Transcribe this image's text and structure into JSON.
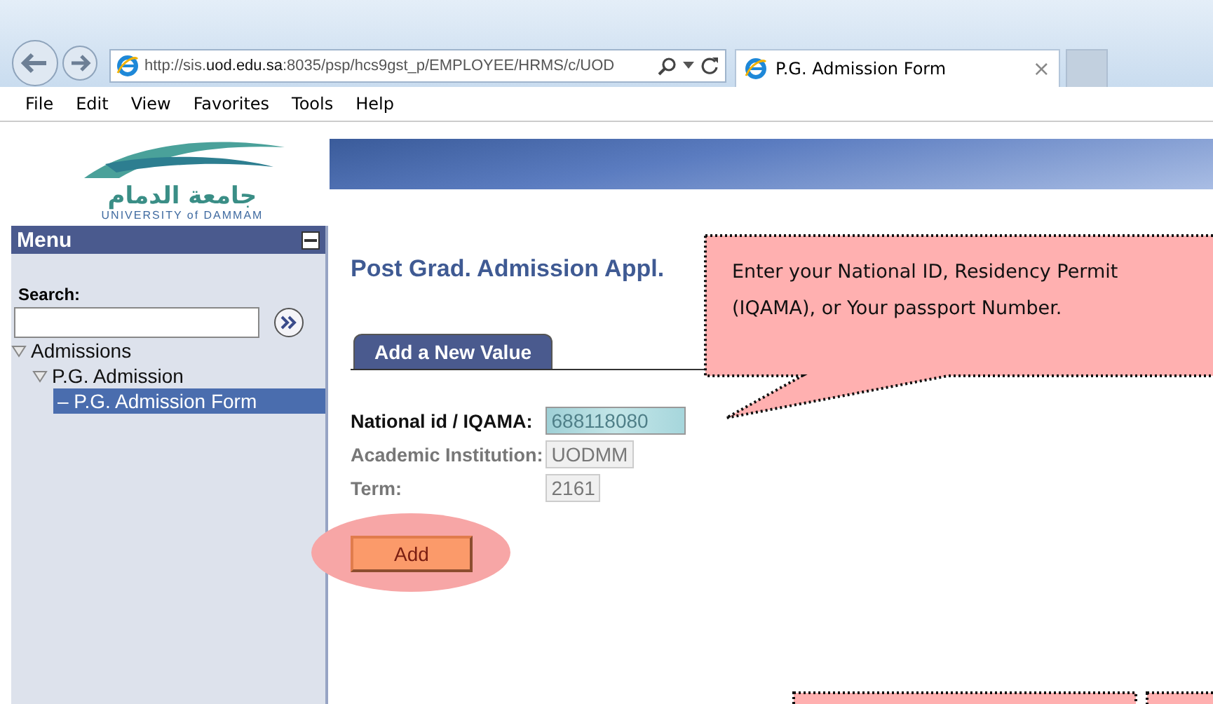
{
  "browser": {
    "address": "http://sis.**uod.edu.sa**:8035/psp/hcs9gst_p/EMPLOYEE/HRMS/c/UOD",
    "tab_title": "P.G. Admission Form",
    "tab_close": "×",
    "menu": [
      "File",
      "Edit",
      "View",
      "Favorites",
      "Tools",
      "Help"
    ]
  },
  "logo": {
    "arabic": "جامعة الدمام",
    "english": "UNIVERSITY of DAMMAM"
  },
  "sidebar": {
    "title": "Menu",
    "search_label": "Search:",
    "tree": [
      {
        "label": "Admissions",
        "expanded": true,
        "selected": false,
        "children": [
          {
            "label": "P.G. Admission",
            "expanded": true,
            "selected": false,
            "children": [
              {
                "label": "– P.G. Admission Form",
                "selected": true
              }
            ]
          }
        ]
      }
    ]
  },
  "page_title": "Post Grad. Admission Appl.",
  "tabs": [
    {
      "label": "Add a New Value",
      "selected": true
    }
  ],
  "fields": [
    {
      "label": "National id / IQAMA:",
      "value": "688118080",
      "disabled": false
    },
    {
      "label": "Academic Institution:",
      "value": "UODMM",
      "disabled": true
    },
    {
      "label": "Term:",
      "value": "2161",
      "disabled": true
    }
  ],
  "add_button": "Add",
  "callout": {
    "text": "Enter your National ID, Residency Permit (IQAMA), or Your passport Number."
  }
}
